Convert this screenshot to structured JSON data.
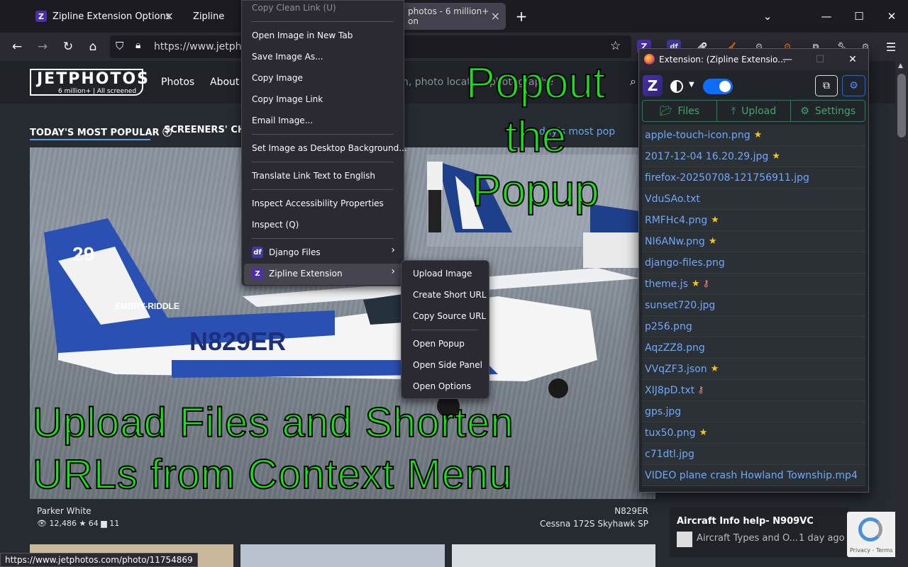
{
  "tabs": [
    {
      "label": "Zipline Extension Options",
      "close": "×"
    },
    {
      "label": "Zipline",
      "close": "×"
    },
    {
      "label": "photos - 6 million+ on",
      "close": "×"
    }
  ],
  "new_tab": "+",
  "window_controls": {
    "list": "⌄",
    "minimize": "—",
    "maximize": "☐",
    "close": "✕"
  },
  "nav": {
    "back": "←",
    "forward": "→",
    "reload": "↻",
    "home": "⌂"
  },
  "url": "https://www.jetphot",
  "site": {
    "logo": "JETPHOTOS",
    "logo_sub": "6 million+ | All screened",
    "nav_photos": "Photos",
    "nav_about": "About",
    "search_placeholder": "n, photo locati..., photographe",
    "popular_tab": "TODAY'S MOST POPULAR ⓘ",
    "screeners_tab": "SCREENERS' CHO",
    "today_link": "day's most pop"
  },
  "captions": {
    "upload_line1": "Upload Files and Shorten",
    "upload_line2": "URLs from Context Menu",
    "popout_lines": [
      "Popout",
      "the",
      "Popup"
    ]
  },
  "photo_meta": {
    "photographer": "Parker White",
    "views": "👁 12,486  ★ 64  ▆ 11",
    "registration": "N829ER",
    "aircraft": "Cessna 172S Skyhawk SP"
  },
  "forum": {
    "title": "Aircraft Info help- N909VC",
    "sub": "Aircraft Types and O...",
    "time": "1 day ago"
  },
  "recaptcha": "Privacy - Terms",
  "status_url": "https://www.jetphotos.com/photo/11754869",
  "context_menu": {
    "copy_clean_link": "Copy Clean Link (U)",
    "open_image_new_tab": "Open Image in New Tab",
    "save_image_as": "Save Image As...",
    "copy_image": "Copy Image",
    "copy_image_link": "Copy Image Link",
    "email_image": "Email Image...",
    "set_desktop_bg": "Set Image as Desktop Background...",
    "translate_link": "Translate Link Text to English",
    "inspect_accessibility": "Inspect Accessibility Properties",
    "inspect": "Inspect (Q)",
    "django_files": "Django Files",
    "zipline_extension": "Zipline Extension",
    "submenu_arrow": "›"
  },
  "submenu": {
    "upload_image": "Upload Image",
    "create_short_url": "Create Short URL",
    "copy_source_url": "Copy Source URL",
    "open_popup": "Open Popup",
    "open_side_panel": "Open Side Panel",
    "open_options": "Open Options"
  },
  "popup": {
    "title": "Extension: (Zipline Extensio...",
    "tabs": {
      "files": "Files",
      "upload": "Upload",
      "settings": "Settings"
    },
    "files": [
      {
        "name": "apple-touch-icon.png",
        "star": true,
        "key": false
      },
      {
        "name": "2017-12-04 16.20.29.jpg",
        "star": true,
        "key": false
      },
      {
        "name": "firefox-20250708-121756911.jpg",
        "star": false,
        "key": false
      },
      {
        "name": "VduSAo.txt",
        "star": false,
        "key": false
      },
      {
        "name": "RMFHc4.png",
        "star": true,
        "key": false
      },
      {
        "name": "NI6ANw.png",
        "star": true,
        "key": false
      },
      {
        "name": "django-files.png",
        "star": false,
        "key": false
      },
      {
        "name": "theme.js",
        "star": true,
        "key": true
      },
      {
        "name": "sunset720.jpg",
        "star": false,
        "key": false
      },
      {
        "name": "p256.png",
        "star": false,
        "key": false
      },
      {
        "name": "AqzZZ8.png",
        "star": false,
        "key": false
      },
      {
        "name": "VVqZF3.json",
        "star": true,
        "key": false
      },
      {
        "name": "XIJ8pD.txt",
        "star": false,
        "key": true
      },
      {
        "name": "gps.jpg",
        "star": false,
        "key": false
      },
      {
        "name": "tux50.png",
        "star": true,
        "key": false
      },
      {
        "name": "c71dtl.jpg",
        "star": false,
        "key": false
      },
      {
        "name": "VIDEO plane crash Howland Township.mp4",
        "star": false,
        "key": false
      }
    ]
  },
  "colors": {
    "accent": "#0d6efd",
    "success": "#198754",
    "link": "#6ea8fe",
    "caption": "#19e019"
  }
}
